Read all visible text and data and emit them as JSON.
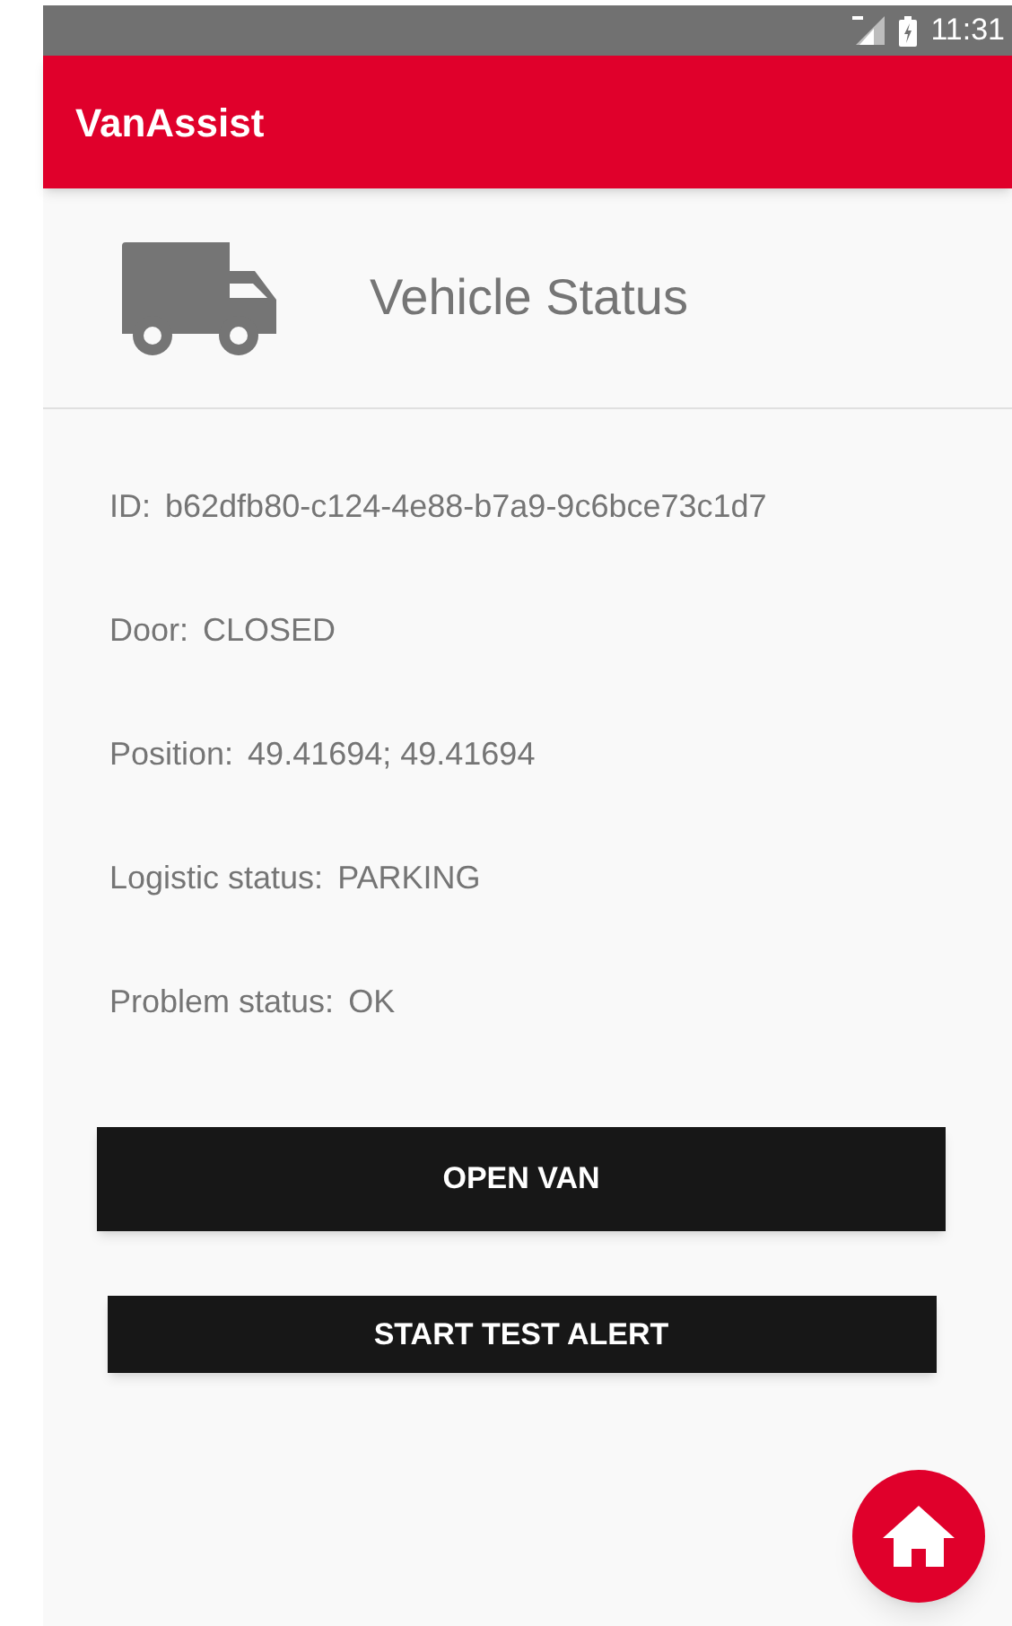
{
  "status_bar": {
    "time": "11:31"
  },
  "app_bar": {
    "title": "VanAssist"
  },
  "header": {
    "title": "Vehicle Status"
  },
  "fields": [
    {
      "label": "ID:",
      "value": "b62dfb80-c124-4e88-b7a9-9c6bce73c1d7"
    },
    {
      "label": "Door:",
      "value": "CLOSED"
    },
    {
      "label": "Position:",
      "value": "49.41694; 49.41694"
    },
    {
      "label": "Logistic status:",
      "value": "PARKING"
    },
    {
      "label": "Problem status:",
      "value": "OK"
    }
  ],
  "buttons": [
    {
      "label": "OPEN VAN"
    },
    {
      "label": "START TEST ALERT"
    }
  ]
}
